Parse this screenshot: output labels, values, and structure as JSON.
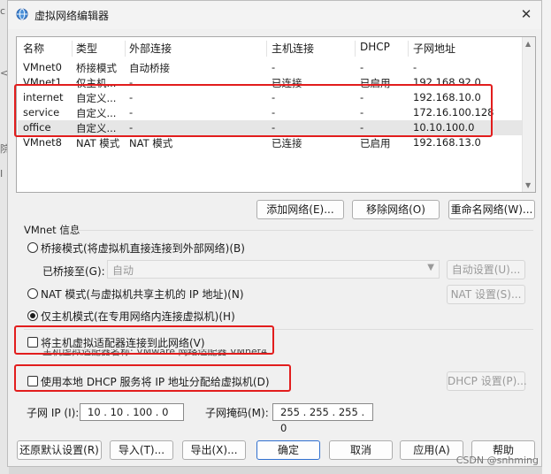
{
  "window": {
    "title": "虚拟网络编辑器",
    "close_glyph": "✕"
  },
  "background": {
    "left_glyphs": [
      "c",
      "<",
      "院",
      "I"
    ]
  },
  "table": {
    "columns": [
      "名称",
      "类型",
      "外部连接",
      "主机连接",
      "DHCP",
      "子网地址"
    ],
    "rows": [
      [
        "VMnet0",
        "桥接模式",
        "自动桥接",
        "-",
        "-",
        "-"
      ],
      [
        "VMnet1",
        "仅主机...",
        "-",
        "已连接",
        "已启用",
        "192.168.92.0"
      ],
      [
        "internet",
        "自定义...",
        "-",
        "-",
        "-",
        "192.168.10.0"
      ],
      [
        "service",
        "自定义...",
        "-",
        "-",
        "-",
        "172.16.100.128"
      ],
      [
        "office",
        "自定义...",
        "-",
        "-",
        "-",
        "10.10.100.0"
      ],
      [
        "VMnet8",
        "NAT 模式",
        "NAT 模式",
        "已连接",
        "已启用",
        "192.168.13.0"
      ]
    ],
    "selected_row": "office"
  },
  "buttons": {
    "add_network": "添加网络(E)...",
    "remove_network": "移除网络(O)",
    "rename_network": "重命名网络(W)...",
    "auto_settings": "自动设置(U)...",
    "nat_settings": "NAT 设置(S)...",
    "dhcp_settings": "DHCP 设置(P)...",
    "restore_defaults": "还原默认设置(R)",
    "import": "导入(T)...",
    "export": "导出(X)...",
    "ok": "确定",
    "cancel": "取消",
    "apply": "应用(A)",
    "help": "帮助"
  },
  "vmnet_info": {
    "group_title": "VMnet 信息",
    "bridged_label": "桥接模式(将虚拟机直接连接到外部网络)(B)",
    "bridged_to_label": "已桥接至(G):",
    "bridged_to_value": "自动",
    "nat_label": "NAT 模式(与虚拟机共享主机的 IP 地址)(N)",
    "host_only_label": "仅主机模式(在专用网络内连接虚拟机)(H)",
    "mode": "host-only",
    "connect_adapter_label": "将主机虚拟适配器连接到此网络(V)",
    "connect_adapter_checked": false,
    "adapter_name_text": "主机虚拟适配器名称: VMware 网络适配器 VMnet4",
    "use_dhcp_label": "使用本地 DHCP 服务将 IP 地址分配给虚拟机(D)",
    "use_dhcp_checked": false,
    "subnet_ip_label": "子网 IP (I):",
    "subnet_ip_value": "10 . 10 . 100 . 0",
    "subnet_mask_label": "子网掩码(M):",
    "subnet_mask_value": "255 . 255 . 255 . 0"
  },
  "watermark": "CSDN @snhming",
  "colors": {
    "highlight": "#e21d1d",
    "primary_border": "#2f6fcf",
    "radio_dot": "#1b1b1b"
  }
}
